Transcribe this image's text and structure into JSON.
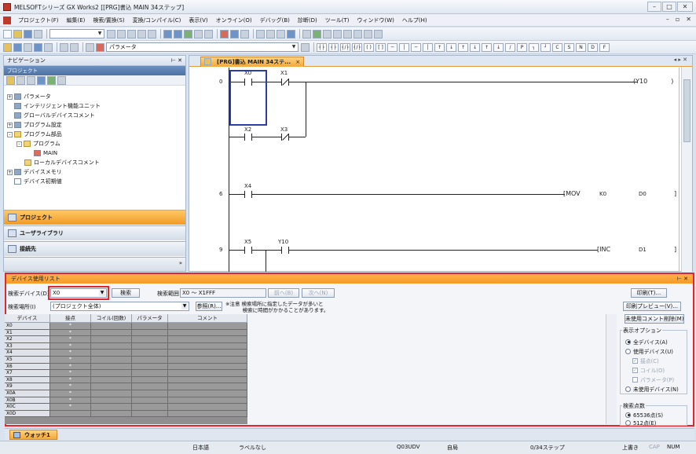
{
  "window": {
    "title": "MELSOFTシリーズ GX Works2 [[PRG]書込 MAIN 34ステップ]"
  },
  "menu": [
    "プロジェクト(F)",
    "編集(E)",
    "検索/置換(S)",
    "変換/コンパイル(C)",
    "表示(V)",
    "オンライン(O)",
    "デバッグ(B)",
    "診断(D)",
    "ツール(T)",
    "ウィンドウ(W)",
    "ヘルプ(H)"
  ],
  "toolbar": {
    "combo_value": "パラメータ"
  },
  "nav": {
    "title": "ナビゲーション",
    "sub_title": "プロジェクト",
    "tree": [
      {
        "label": "パラメータ",
        "expander": "+"
      },
      {
        "label": "インテリジェント機能ユニット",
        "expander": ""
      },
      {
        "label": "グローバルデバイスコメント",
        "expander": ""
      },
      {
        "label": "プログラム設定",
        "expander": "+"
      },
      {
        "label": "プログラム部品",
        "expander": "-"
      },
      {
        "label": "プログラム",
        "expander": "-"
      },
      {
        "label": "MAIN",
        "expander": ""
      },
      {
        "label": "ローカルデバイスコメント",
        "expander": ""
      },
      {
        "label": "デバイスメモリ",
        "expander": "+"
      },
      {
        "label": "デバイス初期値",
        "expander": ""
      }
    ],
    "tabs": [
      "プロジェクト",
      "ユーザライブラリ",
      "接続先"
    ]
  },
  "editor": {
    "tab_label": "[PRG]書込 MAIN 34ステ...",
    "rungs": [
      {
        "step": "0",
        "contacts": [
          "X0",
          "X1",
          "X2",
          "X3"
        ],
        "output": "Y10"
      },
      {
        "step": "6",
        "contacts": [
          "X4"
        ],
        "instr": "MOV",
        "op1": "K0",
        "op2": "D0"
      },
      {
        "step": "9",
        "contacts": [
          "X5",
          "Y10"
        ],
        "instr": "INC",
        "op1": "D1"
      }
    ]
  },
  "device_list": {
    "title": "デバイス使用リスト",
    "search_device_label": "検索デバイス(D)",
    "search_device_value": "X0",
    "search_button": "検索",
    "search_range_label": "検索範囲",
    "search_range_value": "X0 ～ X1FFF",
    "prev_button": "前へ(B)",
    "next_button": "次へ(N)",
    "search_location_label": "検索場所(I)",
    "search_location_value": "(プロジェクト全体)",
    "browse_button": "参照(R)...",
    "note": "※注意 検索場所に指定したデータが多いと\n　　　 検索に時間がかかることがあります。",
    "columns": [
      "デバイス",
      "接点",
      "コイル(回数)",
      "パラメータ",
      "コメント"
    ],
    "rows": [
      {
        "device": "X0",
        "contact": "*"
      },
      {
        "device": "X1",
        "contact": "*"
      },
      {
        "device": "X2",
        "contact": "*"
      },
      {
        "device": "X3",
        "contact": "*"
      },
      {
        "device": "X4",
        "contact": "*"
      },
      {
        "device": "X5",
        "contact": "*"
      },
      {
        "device": "X6",
        "contact": "*"
      },
      {
        "device": "X7",
        "contact": "*"
      },
      {
        "device": "X8",
        "contact": "*"
      },
      {
        "device": "X9",
        "contact": "*"
      },
      {
        "device": "X0A",
        "contact": "*"
      },
      {
        "device": "X0B",
        "contact": "*"
      },
      {
        "device": "X0C",
        "contact": "*"
      },
      {
        "device": "X0D",
        "contact": ""
      }
    ],
    "print_button": "印刷(T)...",
    "print_preview_button": "印刷プレビュー(V)...",
    "delete_unused_comment_button": "未使用コメント削除(M)",
    "display_options_title": "表示オプション",
    "opt_all": "全デバイス(A)",
    "opt_used": "使用デバイス(U)",
    "opt_contact": "接点(C)",
    "opt_coil": "コイル(O)",
    "opt_param": "パラメータ(P)",
    "opt_unused": "未使用デバイス(N)",
    "search_points_title": "検索点数",
    "opt_65536": "65536点(S)",
    "opt_512": "512点(E)"
  },
  "watch": {
    "tab_label": "ウォッチ1"
  },
  "status": {
    "language": "日本語",
    "label": "ラベルなし",
    "cpu": "Q03UDV",
    "station": "自局",
    "steps": "0/34ステップ",
    "mode": "上書き",
    "cap": "CAP",
    "num": "NUM"
  }
}
